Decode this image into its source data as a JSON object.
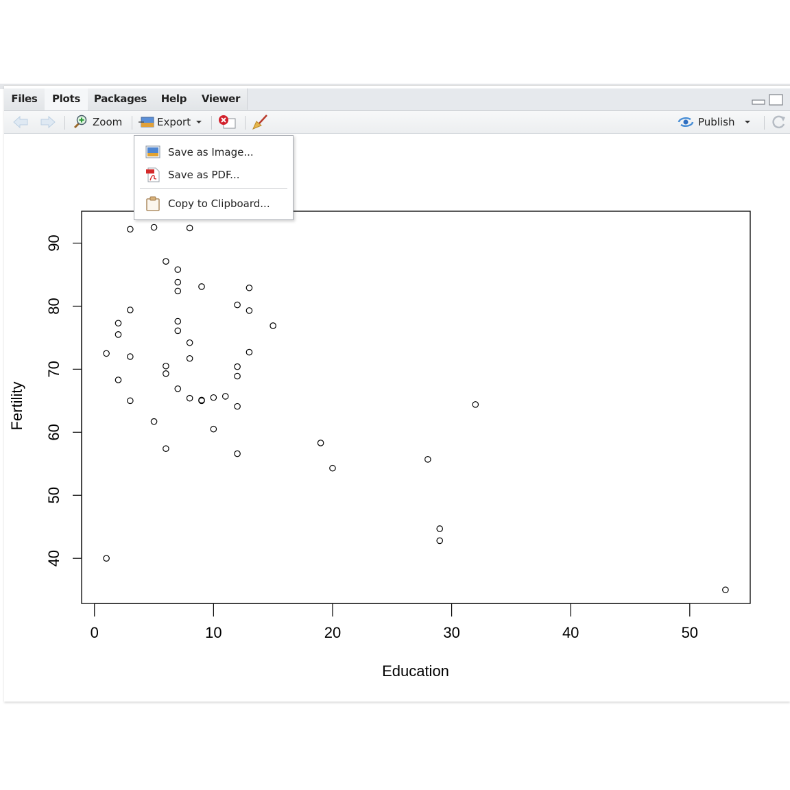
{
  "tabs": [
    {
      "label": "Files",
      "active": false
    },
    {
      "label": "Plots",
      "active": true
    },
    {
      "label": "Packages",
      "active": false
    },
    {
      "label": "Help",
      "active": false
    },
    {
      "label": "Viewer",
      "active": false
    }
  ],
  "toolbar": {
    "back_icon": "arrow-left-icon",
    "forward_icon": "arrow-right-icon",
    "zoom_label": "Zoom",
    "export_label": "Export",
    "remove_icon": "remove-plot-icon",
    "clear_icon": "broom-icon",
    "publish_label": "Publish",
    "refresh_icon": "refresh-icon"
  },
  "export_menu": {
    "items": [
      {
        "label": "Save as Image...",
        "icon": "image-icon"
      },
      {
        "label": "Save as PDF...",
        "icon": "pdf-icon"
      },
      {
        "label": "Copy to Clipboard...",
        "icon": "clipboard-icon"
      }
    ]
  },
  "chart_data": {
    "type": "scatter",
    "title": "",
    "xlabel": "Education",
    "ylabel": "Fertility",
    "xlim": [
      -1.08,
      55.08
    ],
    "ylim": [
      32.84,
      95.06
    ],
    "xticks": [
      0,
      10,
      20,
      30,
      40,
      50
    ],
    "yticks": [
      40,
      50,
      60,
      70,
      80,
      90
    ],
    "grid": false,
    "legend": "none",
    "marker": "open-circle",
    "x": [
      12,
      9,
      5,
      7,
      15,
      7,
      7,
      8,
      7,
      13,
      6,
      12,
      7,
      12,
      5,
      2,
      8,
      28,
      20,
      9,
      10,
      3,
      12,
      6,
      1,
      8,
      3,
      10,
      19,
      8,
      2,
      6,
      2,
      6,
      3,
      9,
      3,
      13,
      12,
      11,
      13,
      32,
      7,
      53,
      29,
      29,
      1
    ],
    "y": [
      80.2,
      83.1,
      92.5,
      85.8,
      76.9,
      76.1,
      83.8,
      92.4,
      82.4,
      82.9,
      87.1,
      64.1,
      66.9,
      68.9,
      61.7,
      68.3,
      71.7,
      55.7,
      54.3,
      65.1,
      65.5,
      65.0,
      56.6,
      57.4,
      72.5,
      74.2,
      72.0,
      60.5,
      58.3,
      65.4,
      75.5,
      69.3,
      77.3,
      70.5,
      79.4,
      65.0,
      92.2,
      79.3,
      70.4,
      65.7,
      72.7,
      64.4,
      77.6,
      35.0,
      44.7,
      42.8,
      40.0
    ]
  }
}
